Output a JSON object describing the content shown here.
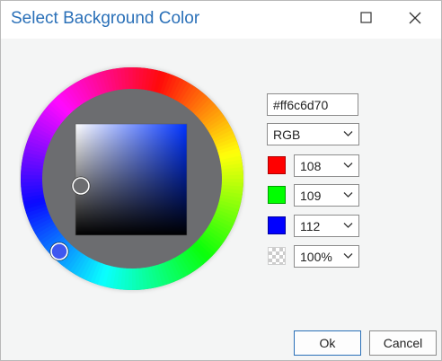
{
  "dialog": {
    "title": "Select Background Color",
    "maximize_icon": "maximize-icon",
    "close_icon": "close-icon"
  },
  "color": {
    "hex": "#ff6c6d70",
    "mode": "RGB",
    "channels": [
      {
        "name": "red",
        "value": "108",
        "swatch": "#ff0000"
      },
      {
        "name": "green",
        "value": "109",
        "swatch": "#00ff00"
      },
      {
        "name": "blue",
        "value": "112",
        "swatch": "#0000ff"
      },
      {
        "name": "alpha",
        "value": "100%",
        "swatch": "transparency-checker"
      }
    ],
    "current_color": "#6c6d70"
  },
  "buttons": {
    "ok_label": "Ok",
    "cancel_label": "Cancel"
  },
  "accent_color": "#2a70b8"
}
